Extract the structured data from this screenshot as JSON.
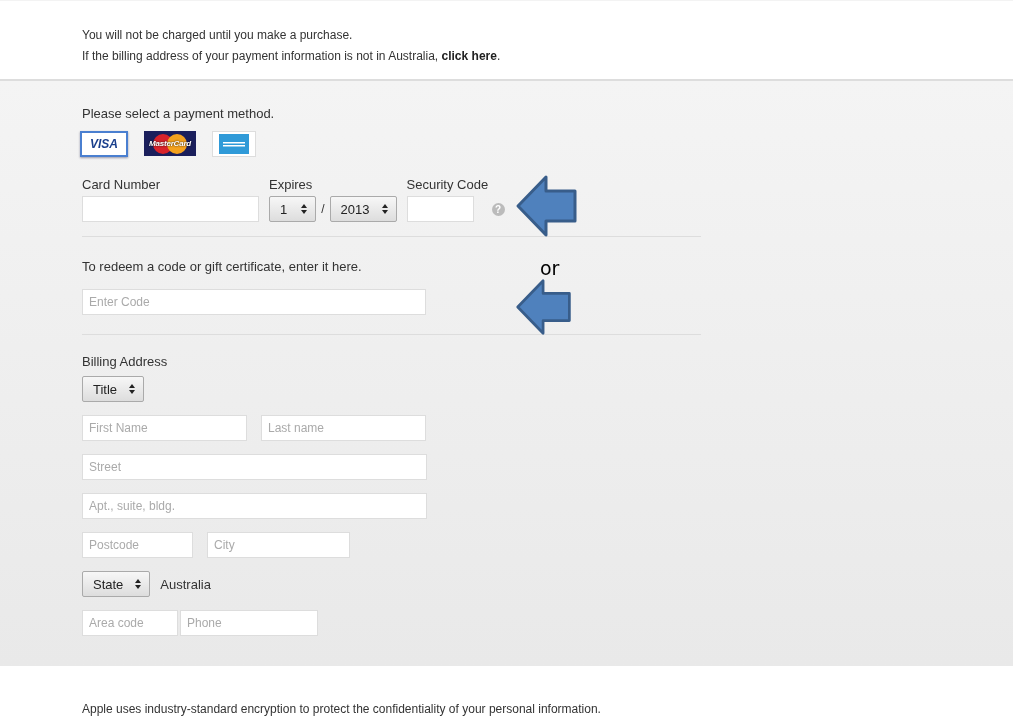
{
  "notice": {
    "lines": [
      "You will not be charged until you make a purchase.",
      "If the billing address of your payment information is not in Australia, **click here**."
    ]
  },
  "payment": {
    "prompt": "Please select a payment method.",
    "methods": [
      {
        "kind": "visa",
        "label": "VISA",
        "selected": true
      },
      {
        "kind": "mastercard",
        "label": "MasterCard",
        "selected": false
      },
      {
        "kind": "amex",
        "selected": false
      }
    ],
    "card_number": {
      "label": "Card Number"
    },
    "expires": {
      "label": "Expires",
      "month": "1",
      "separator": "/",
      "year": "2013"
    },
    "security_code": {
      "label": "Security Code",
      "help": "?"
    }
  },
  "redeem": {
    "prompt": "To redeem a code or gift certificate, enter it here.",
    "placeholder": "Enter Code"
  },
  "billing": {
    "title": "Billing Address",
    "rows": [
      [
        {
          "kind": "select",
          "value": "Title"
        }
      ],
      [
        {
          "kind": "input",
          "placeholder": "First Name"
        },
        {
          "kind": "input",
          "placeholder": "Last name"
        }
      ],
      [
        {
          "kind": "input",
          "placeholder": "Street"
        }
      ],
      [
        {
          "kind": "input",
          "placeholder": "Apt., suite, bldg."
        }
      ],
      [
        {
          "kind": "input",
          "placeholder": "Postcode"
        },
        {
          "kind": "input",
          "placeholder": "City"
        }
      ],
      [
        {
          "kind": "select",
          "value": "State"
        },
        {
          "kind": "text",
          "text": "Australia"
        }
      ],
      [
        {
          "kind": "input",
          "placeholder": "Area code"
        },
        {
          "kind": "input",
          "placeholder": "Phone"
        }
      ]
    ]
  },
  "annotations": {
    "separator_text": "or"
  },
  "footer": {
    "text": "Apple uses industry-standard encryption to protect the confidentiality of your personal information."
  }
}
